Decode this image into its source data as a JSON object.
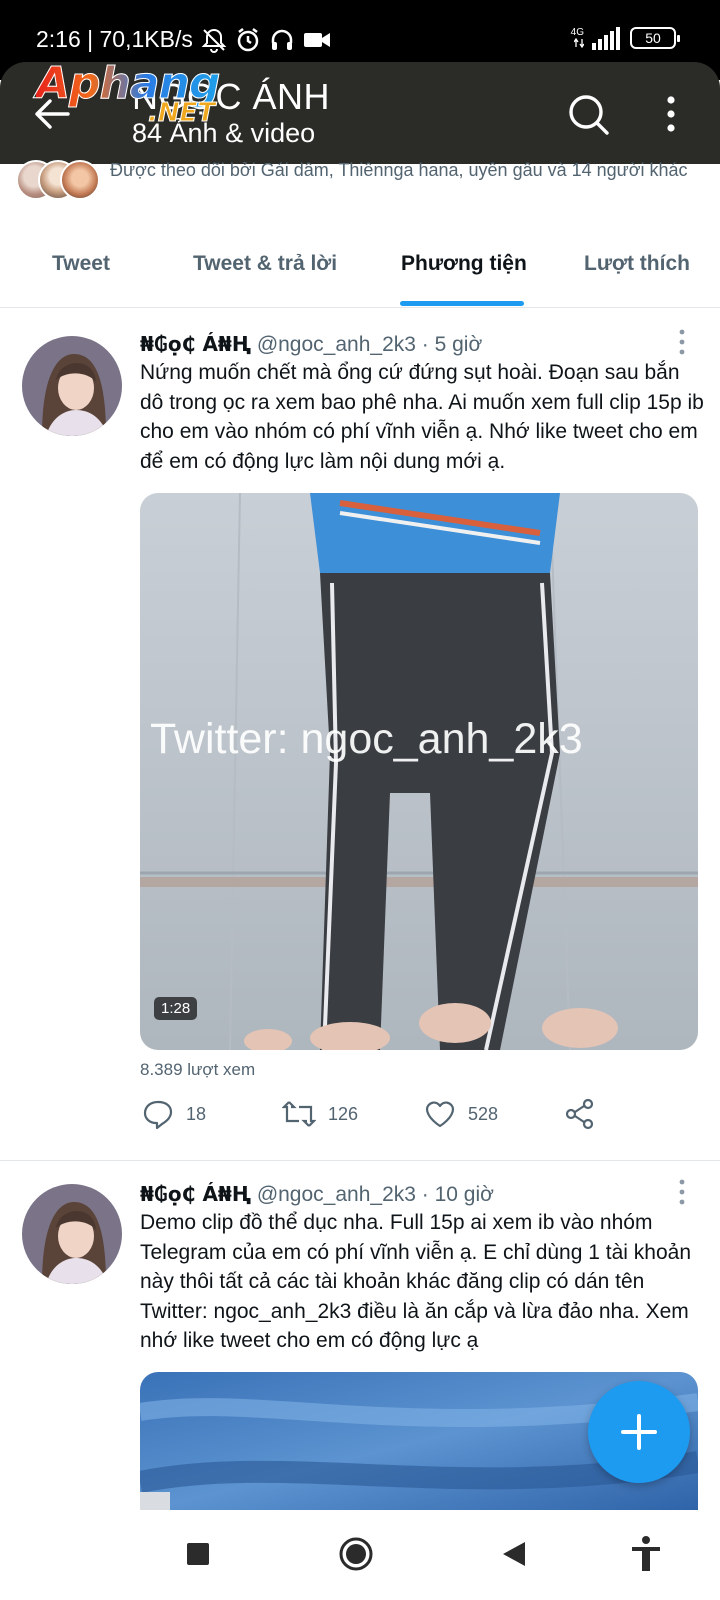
{
  "status_bar": {
    "time_speed": "2:16 | 70,1KB/s",
    "network": "4G",
    "battery": "50"
  },
  "header": {
    "title": "NGỌC ÁNH",
    "subtitle": "84 Ảnh & video"
  },
  "watermark_logo": {
    "main": "Aphang",
    "suffix": ".NET"
  },
  "followers": {
    "text": "Được theo dõi bởi Gái dâm, Thiênnga hana, uyên gâu và 14 người khác"
  },
  "tabs": [
    {
      "label": "Tweet",
      "active": false
    },
    {
      "label": "Tweet & trả lời",
      "active": false
    },
    {
      "label": "Phương tiện",
      "active": true
    },
    {
      "label": "Lượt thích",
      "active": false
    }
  ],
  "tweets": [
    {
      "name": "₦₲ọ₵ Á₦Ⱨ",
      "handle": "@ngoc_anh_2k3",
      "time": "· 5 giờ",
      "text": "Nứng muốn chết mà ổng cứ đứng sụt hoài. Đoạn sau bắn dô trong ọc ra xem bao phê nha. Ai muốn xem full clip 15p ib cho em vào nhóm có phí vĩnh viễn ạ. Nhớ like tweet cho em để em có động lực làm nội dung mới ạ.",
      "media_watermark": "Twitter: ngoc_anh_2k3",
      "duration": "1:28",
      "views": "8.389 lượt xem",
      "replies": "18",
      "retweets": "126",
      "likes": "528"
    },
    {
      "name": "₦₲ọ₵ Á₦Ⱨ",
      "handle": "@ngoc_anh_2k3",
      "time": "· 10 giờ",
      "text": "Demo clip đồ thể dục nha. Full 15p ai xem ib vào nhóm Telegram của em có phí vĩnh viễn ạ. E chỉ dùng 1 tài khoản này thôi tất cả các tài khoản khác đăng clip có dán tên Twitter: ngoc_anh_2k3 điều là ăn cắp và lừa đảo nha. Xem nhớ like tweet cho em có động lực ạ"
    }
  ],
  "icons": {
    "back": "arrow-left-icon",
    "search": "search-icon",
    "more": "more-vertical-icon",
    "reply": "reply-icon",
    "retweet": "retweet-icon",
    "like": "heart-icon",
    "share": "share-icon",
    "compose": "plus-icon"
  },
  "colors": {
    "accent": "#1d9bf0",
    "header_bg": "#2b2b27",
    "muted_text": "#536471"
  }
}
